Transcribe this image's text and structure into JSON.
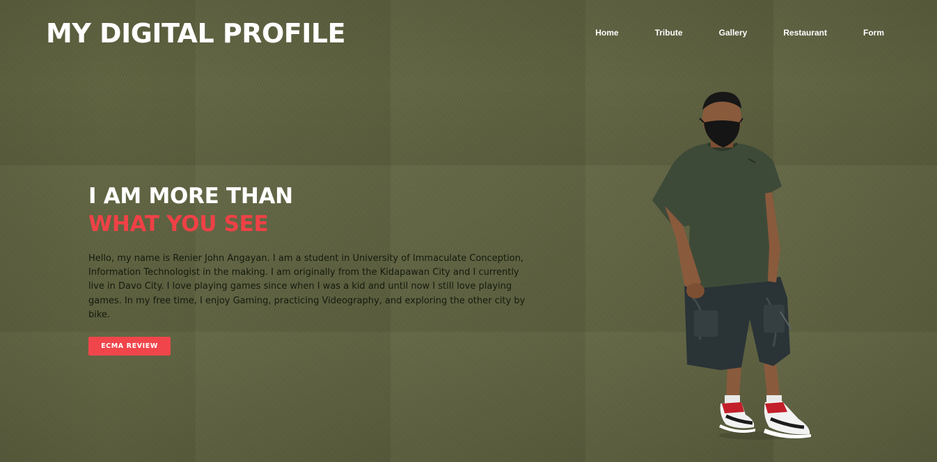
{
  "header": {
    "logo_text": "MY DIGITAL PROFILE",
    "nav": [
      {
        "label": "Home"
      },
      {
        "label": "Tribute"
      },
      {
        "label": "Gallery"
      },
      {
        "label": "Restaurant"
      },
      {
        "label": "Form"
      }
    ]
  },
  "hero": {
    "headline_line1": "I AM MORE THAN",
    "headline_line2": "WHAT YOU SEE",
    "bio": "Hello, my name is Renier John Angayan. I am a student in University of Immaculate Conception, Information Technologist in the making. I am originally from the Kidapawan City and I currently live in Davo City. I love playing games since when I was a kid and until now I still love playing games. In my free time, I enjoy Gaming, practicing Videography, and exploring the other city by bike.",
    "cta_label": "ECMA REVIEW"
  },
  "colors": {
    "background": "#5f6340",
    "accent": "#ef4146",
    "text_light": "#ffffff",
    "text_dark": "#141a0e"
  }
}
